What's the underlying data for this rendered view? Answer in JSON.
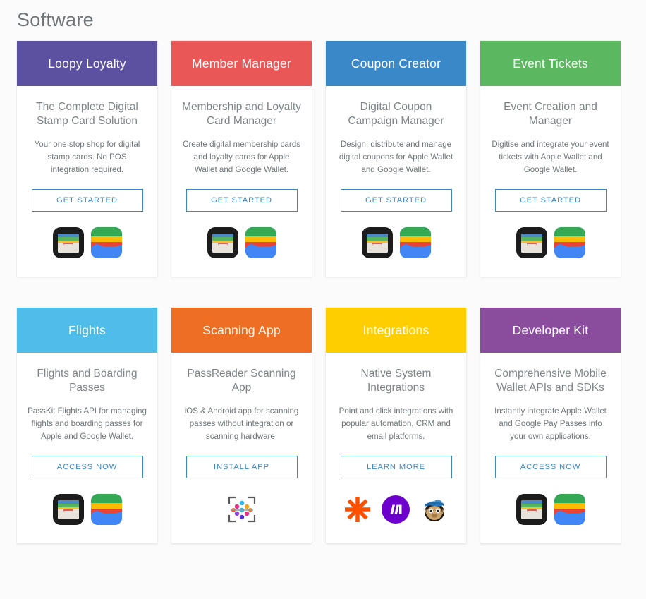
{
  "page": {
    "title": "Software",
    "background_color": "#fbfbfb"
  },
  "cards": [
    {
      "name": "loopy-loyalty",
      "header": "Loopy Loyalty",
      "header_color": "#5b51a0",
      "title": "The Complete Digital Stamp Card Solution",
      "description": "Your one stop shop for digital stamp cards. No POS integration required.",
      "button": "GET STARTED",
      "icons": [
        "apple-wallet-icon",
        "google-wallet-icon"
      ]
    },
    {
      "name": "member-manager",
      "header": "Member Manager",
      "header_color": "#ea5757",
      "title": "Membership and Loyalty Card Manager",
      "description": "Create digital membership cards and loyalty cards for Apple Wallet and Google Wallet.",
      "button": "GET STARTED",
      "icons": [
        "apple-wallet-icon",
        "google-wallet-icon"
      ]
    },
    {
      "name": "coupon-creator",
      "header": "Coupon Creator",
      "header_color": "#3b88c9",
      "title": "Digital Coupon Campaign Manager",
      "description": "Design, distribute and manage digital coupons for Apple Wallet and Google Wallet.",
      "button": "GET STARTED",
      "icons": [
        "apple-wallet-icon",
        "google-wallet-icon"
      ]
    },
    {
      "name": "event-tickets",
      "header": "Event Tickets",
      "header_color": "#5cb860",
      "title": "Event Creation and Manager",
      "description": "Digitise and integrate your event tickets with Apple Wallet and Google Wallet.",
      "button": "GET STARTED",
      "icons": [
        "apple-wallet-icon",
        "google-wallet-icon"
      ]
    },
    {
      "name": "flights",
      "header": "Flights",
      "header_color": "#4fbdea",
      "title": "Flights and Boarding Passes",
      "description": "PassKit Flights API for managing flights and boarding passes for Apple and Google Wallet.",
      "button": "ACCESS NOW",
      "icons": [
        "apple-wallet-icon",
        "google-wallet-icon"
      ]
    },
    {
      "name": "scanning-app",
      "header": "Scanning App",
      "header_color": "#ee6f24",
      "title": "PassReader Scanning App",
      "description": "iOS & Android app for scanning passes without integration or scanning hardware.",
      "button": "INSTALL APP",
      "icons": [
        "passreader-icon"
      ]
    },
    {
      "name": "integrations",
      "header": "Integrations",
      "header_color": "#ffce00",
      "title": "Native System Integrations",
      "description": "Point and click integrations with popular automation, CRM and email platforms.",
      "button": "LEARN MORE",
      "icons": [
        "zapier-icon",
        "make-icon",
        "mailchimp-icon"
      ]
    },
    {
      "name": "developer-kit",
      "header": "Developer Kit",
      "header_color": "#8a4d9e",
      "title": "Comprehensive Mobile Wallet APIs and SDKs",
      "description": "Instantly integrate Apple Wallet and Google Pay Passes into your own applications.",
      "button": "ACCESS NOW",
      "icons": [
        "apple-wallet-icon",
        "google-wallet-icon"
      ]
    }
  ],
  "colors": {
    "button_border": "#3b88c9",
    "button_text": "#3b88c9",
    "card_background": "#ffffff",
    "title_text": "#7e8589",
    "body_text": "#6f7579"
  }
}
